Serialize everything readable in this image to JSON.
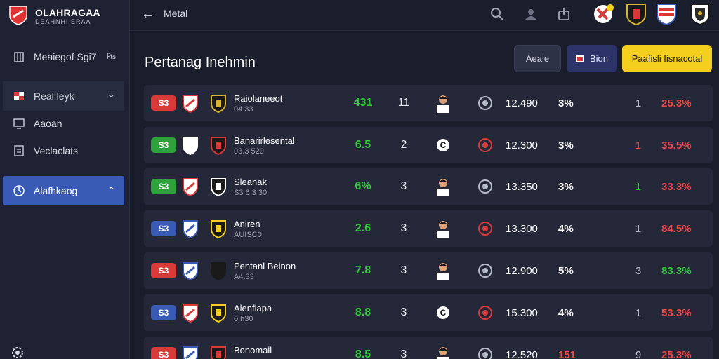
{
  "brand": {
    "title": "OLAHRAGAA",
    "subtitle": "DEAHNHI ERAA"
  },
  "sidebar": {
    "items": [
      {
        "label": "Meaiegof Sgi7",
        "icon": "building-icon",
        "suffix": "₧"
      },
      {
        "label": "Real leyk",
        "icon": "flag-icon",
        "suffix": "⌄"
      },
      {
        "label": "Aaoan",
        "icon": "monitor-icon",
        "suffix": ""
      },
      {
        "label": "Veclaclats",
        "icon": "document-icon",
        "suffix": ""
      },
      {
        "label": "Alafhkaog",
        "icon": "clock-icon",
        "suffix": "⌃"
      }
    ]
  },
  "topbar": {
    "back": "←",
    "title": "Metal"
  },
  "main": {
    "title": "Pertanag Inehmin",
    "buttons": {
      "first": "Aeaie",
      "second": "Bion",
      "primary": "Paafisli Iisnacotal"
    }
  },
  "colors": {
    "accent_blue": "#3a5bb5",
    "primary_yellow": "#f4cf1e",
    "odds_green": "#33c73a",
    "rate_red": "#ef4545"
  },
  "rows": [
    {
      "pill": "S3",
      "pill_color": "#d83a3a",
      "name": "Raiolaneeot",
      "time": "04.33",
      "odds": "431",
      "odds_color": "#33c73a",
      "rank": "11",
      "player": "avatar",
      "price": "12.490",
      "pct": "3%",
      "count": "1",
      "count_color": "#b7bccb",
      "rate": "25.3%",
      "rate_color": "#ef4545"
    },
    {
      "pill": "S3",
      "pill_color": "#2fa13a",
      "name": "Banarirlesental",
      "time": "03.3 520",
      "odds": "6.5",
      "odds_color": "#33c73a",
      "rank": "2",
      "player": "letter",
      "player_letter": "C",
      "price": "12.300",
      "pct": "3%",
      "count": "1",
      "count_color": "#ef4545",
      "rate": "35.5%",
      "rate_color": "#ef4545"
    },
    {
      "pill": "S3",
      "pill_color": "#2fa13a",
      "name": "Sleanak",
      "time": "S3 6 3 30",
      "odds": "6%",
      "odds_color": "#33c73a",
      "rank": "3",
      "player": "avatar",
      "price": "13.350",
      "pct": "3%",
      "count": "1",
      "count_color": "#33c73a",
      "rate": "33.3%",
      "rate_color": "#ef4545"
    },
    {
      "pill": "S3",
      "pill_color": "#3a5bb5",
      "name": "Aniren",
      "time": "AUISC0",
      "odds": "2.6",
      "odds_color": "#33c73a",
      "rank": "3",
      "player": "avatar",
      "price": "13.300",
      "pct": "4%",
      "count": "1",
      "count_color": "#b7bccb",
      "rate": "84.5%",
      "rate_color": "#ef4545"
    },
    {
      "pill": "S3",
      "pill_color": "#d83a3a",
      "name": "Pentanl Beinon",
      "time": "A4.33",
      "odds": "7.8",
      "odds_color": "#33c73a",
      "rank": "3",
      "player": "avatar",
      "price": "12.900",
      "pct": "5%",
      "count": "3",
      "count_color": "#b7bccb",
      "rate": "83.3%",
      "rate_color": "#33c73a"
    },
    {
      "pill": "S3",
      "pill_color": "#3a5bb5",
      "name": "Alenfiapa",
      "time": "0.h30",
      "odds": "8.8",
      "odds_color": "#33c73a",
      "rank": "3",
      "player": "letter",
      "player_letter": "C",
      "price": "15.300",
      "pct": "4%",
      "count": "1",
      "count_color": "#b7bccb",
      "rate": "53.3%",
      "rate_color": "#ef4545"
    },
    {
      "pill": "S3",
      "pill_color": "#d83a3a",
      "name": "Bonomail",
      "time": "",
      "odds": "8.5",
      "odds_color": "#33c73a",
      "rank": "3",
      "player": "avatar",
      "price": "12.520",
      "pct": "151",
      "pct_color": "#ef4545",
      "count": "9",
      "count_color": "#b7bccb",
      "rate": "25.3%",
      "rate_color": "#ef4545"
    }
  ]
}
